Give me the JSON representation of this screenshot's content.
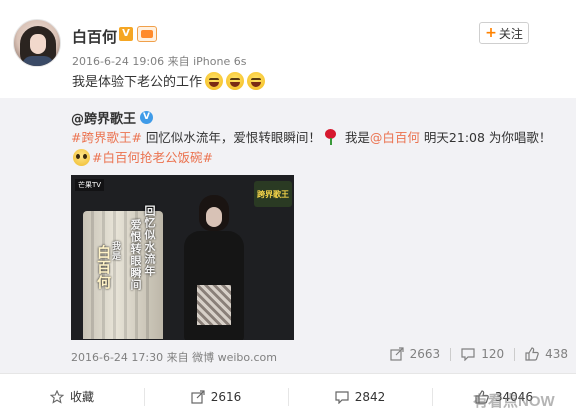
{
  "post": {
    "username": "白百何",
    "vip_badge": "V",
    "follow_label": "关注",
    "meta": "2016-6-24 19:06 来自 iPhone 6s",
    "text": "我是体验下老公的工作",
    "emojis": [
      "laugh-cry-emoji",
      "laugh-cry-emoji",
      "laugh-cry-emoji"
    ]
  },
  "repost": {
    "username": "@跨界歌王",
    "text_parts": {
      "hashtag1": "#跨界歌王#",
      "text1": " 回忆似水流年，爱恨转眼瞬间！",
      "text2": " 我是",
      "mention": "@白百何",
      "text3": " 明天21:08 为你唱歌！",
      "hashtag2": "#白百何抢老公饭碗#"
    },
    "media_overlay": {
      "line1": "回忆似水流年",
      "line2": "爱恨转眼瞬间",
      "line3": "我是",
      "line4": "白百何",
      "corner": "芒果TV",
      "logo": "跨界歌王"
    },
    "meta": "2016-6-24 17:30 来自 微博 weibo.com",
    "actions": {
      "repost_count": "2663",
      "comment_count": "120",
      "like_count": "438"
    }
  },
  "bottom_bar": {
    "favorite_label": "收藏",
    "repost_count": "2616",
    "comment_count": "2842",
    "like_count": "34046"
  },
  "watermark": "有看点NOW",
  "colors": {
    "link": "#eb7350",
    "accent": "#ff8200",
    "verified": "#3f9be8",
    "repost_bg": "#f2f2f5"
  }
}
